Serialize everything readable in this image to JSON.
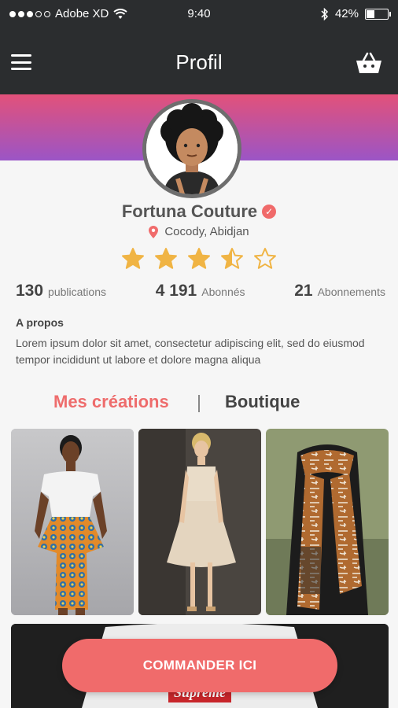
{
  "statusbar": {
    "carrier": "Adobe XD",
    "time": "9:40",
    "battery_pct": "42%",
    "battery_level": 0.42,
    "signal_filled": 3,
    "signal_total": 5
  },
  "navbar": {
    "title": "Profil",
    "menu_icon": "hamburger-icon",
    "cart_icon": "basket-icon"
  },
  "profile": {
    "name": "Fortuna Couture",
    "verified": true,
    "location": "Cocody, Abidjan",
    "rating": 3.5,
    "rating_max": 5
  },
  "stats": [
    {
      "value": "130",
      "label": "publications"
    },
    {
      "value": "4 191",
      "label": "Abonnés"
    },
    {
      "value": "21",
      "label": "Abonnements"
    }
  ],
  "about": {
    "title": "A propos",
    "text": "Lorem ipsum dolor sit amet, consectetur adipiscing elit, sed do eiusmod tempor incididunt ut labore et dolore magna aliqua"
  },
  "tabs": {
    "active": "Mes créations",
    "other": "Boutique"
  },
  "gallery": [
    {
      "name": "gallery-item-peplum-skirt"
    },
    {
      "name": "gallery-item-beige-dress"
    },
    {
      "name": "gallery-item-wax-scarf"
    }
  ],
  "cta": {
    "label": "COMMANDER ICI"
  },
  "colors": {
    "dark": "#2b2d2f",
    "accent": "#f06b6b",
    "gradient_top": "#e2517a",
    "gradient_bottom": "#9b55c6",
    "star": "#f0b444"
  }
}
